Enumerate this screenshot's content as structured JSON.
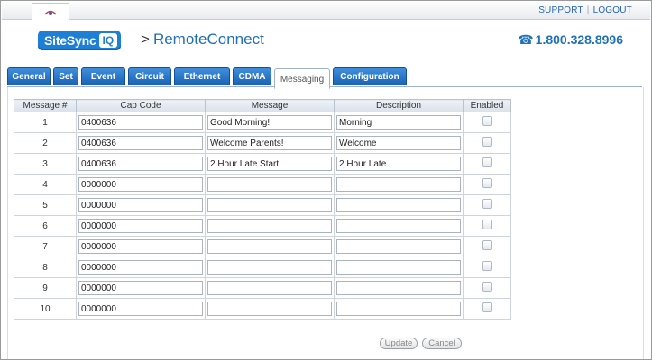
{
  "header": {
    "support_link": "SUPPORT",
    "separator": "|",
    "logout_link": "LOGOUT",
    "logo_text": "SiteSync",
    "logo_badge": "IQ",
    "title_sep": ">",
    "title_prefix": "Remote",
    "title_suffix": "Connect",
    "phone_icon": "☎",
    "phone": "1.800.328.8996",
    "browser_tab_icon": "site-favicon-icon"
  },
  "tabs": [
    {
      "label": "General"
    },
    {
      "label": "Set"
    },
    {
      "label": "Event"
    },
    {
      "label": "Circuit"
    },
    {
      "label": "Ethernet"
    },
    {
      "label": "CDMA"
    },
    {
      "label": "Messaging"
    },
    {
      "label": "Configuration"
    }
  ],
  "active_tab": "Messaging",
  "table": {
    "columns": [
      "Message #",
      "Cap Code",
      "Message",
      "Description",
      "Enabled"
    ],
    "rows": [
      {
        "num": "1",
        "cap": "0400636",
        "msg": "Good Morning!",
        "desc": "Morning",
        "enabled": false
      },
      {
        "num": "2",
        "cap": "0400636",
        "msg": "Welcome Parents!",
        "desc": "Welcome",
        "enabled": false
      },
      {
        "num": "3",
        "cap": "0400636",
        "msg": "2 Hour Late Start",
        "desc": "2 Hour Late",
        "enabled": false
      },
      {
        "num": "4",
        "cap": "0000000",
        "msg": "",
        "desc": "",
        "enabled": false
      },
      {
        "num": "5",
        "cap": "0000000",
        "msg": "",
        "desc": "",
        "enabled": false
      },
      {
        "num": "6",
        "cap": "0000000",
        "msg": "",
        "desc": "",
        "enabled": false
      },
      {
        "num": "7",
        "cap": "0000000",
        "msg": "",
        "desc": "",
        "enabled": false
      },
      {
        "num": "8",
        "cap": "0000000",
        "msg": "",
        "desc": "",
        "enabled": false
      },
      {
        "num": "9",
        "cap": "0000000",
        "msg": "",
        "desc": "",
        "enabled": false
      },
      {
        "num": "10",
        "cap": "0000000",
        "msg": "",
        "desc": "",
        "enabled": false
      }
    ]
  },
  "buttons": {
    "update": "Update",
    "cancel": "Cancel"
  },
  "colors": {
    "brand_blue": "#1e7fd6",
    "tab_blue": "#1b63b6",
    "link_blue": "#2a63b5"
  }
}
